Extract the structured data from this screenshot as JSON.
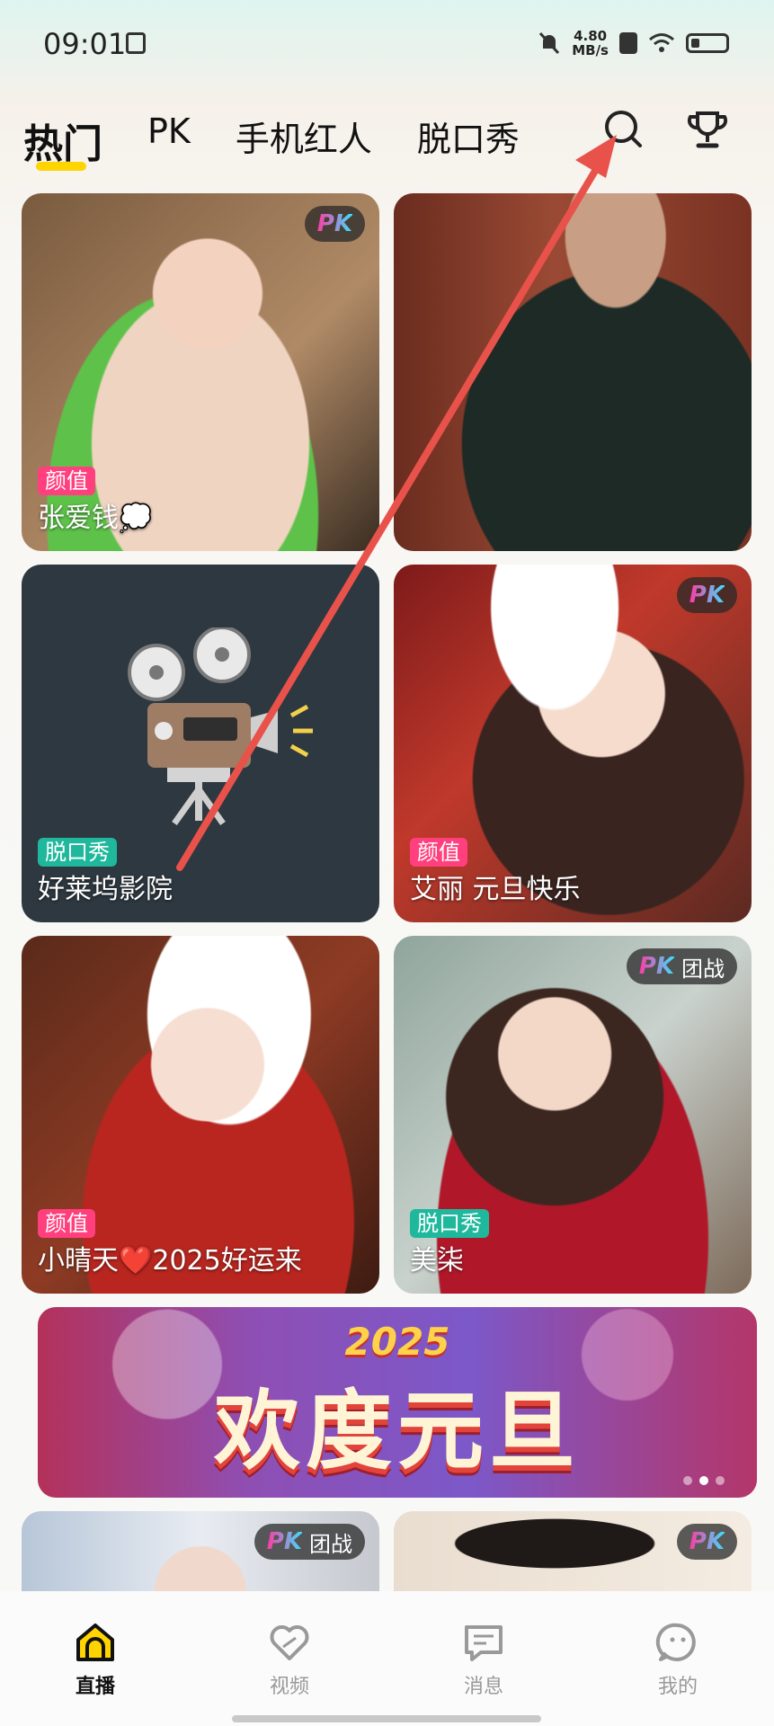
{
  "status_bar": {
    "time": "09:01",
    "net_speed_value": "4.80",
    "net_speed_unit": "MB/s"
  },
  "tabs": [
    {
      "label": "热门",
      "active": true
    },
    {
      "label": "PK"
    },
    {
      "label": "手机红人"
    },
    {
      "label": "脱口秀"
    }
  ],
  "tab_icons": [
    "search-icon",
    "trophy-icon"
  ],
  "cards": [
    {
      "title": "张爱钱💭",
      "tag": "颜值",
      "badge": "PK"
    },
    {
      "title": "",
      "tag": "",
      "badge": ""
    },
    {
      "title": "好莱坞影院",
      "tag": "脱口秀",
      "badge": ""
    },
    {
      "title": "艾丽 元旦快乐",
      "tag": "颜值",
      "badge": "PK"
    },
    {
      "title": "小晴天❤️2025好运来",
      "tag": "颜值",
      "badge": "PK"
    },
    {
      "title": "美柒",
      "tag": "脱口秀",
      "badge": "PK",
      "badge_extra": "团战"
    }
  ],
  "banner": {
    "year": "2025",
    "headline": "欢度元旦"
  },
  "partial_cards": [
    {
      "badge": "PK",
      "badge_extra": "团战"
    },
    {
      "badge": "PK"
    }
  ],
  "bottom_nav": [
    {
      "label": "直播",
      "icon": "live-home-icon",
      "active": true
    },
    {
      "label": "视频",
      "icon": "heart-icon"
    },
    {
      "label": "消息",
      "icon": "message-icon"
    },
    {
      "label": "我的",
      "icon": "profile-icon"
    }
  ],
  "colors": {
    "accent_yellow": "#ffd400",
    "tag_pink": "#ff3f7e",
    "tag_green": "#1fb89c",
    "annotation_red": "#e8524a"
  }
}
